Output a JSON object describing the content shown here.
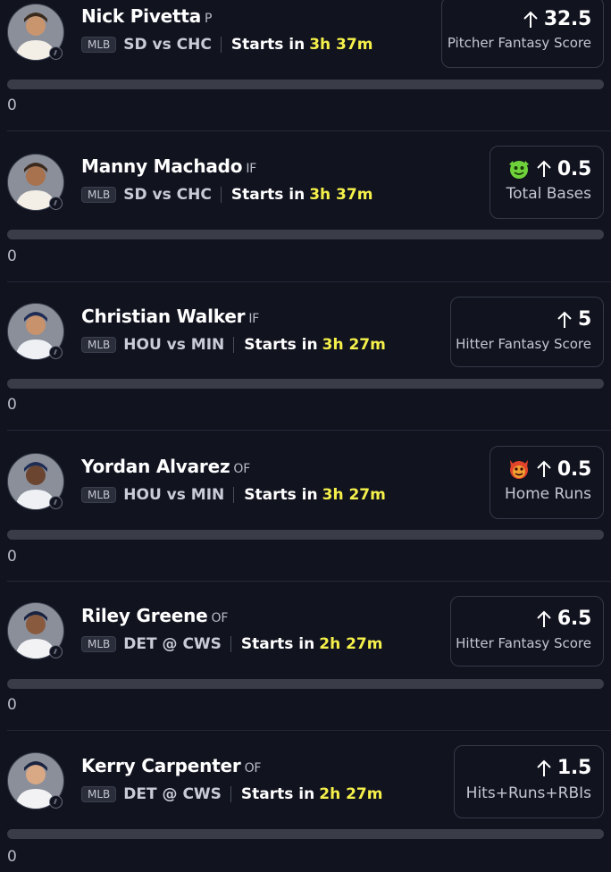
{
  "players": [
    {
      "name": "Nick Pivetta",
      "position": "P",
      "league": "MLB",
      "matchup": "SD vs CHC",
      "starts_label": "Starts in",
      "starts_time": "3h 37m",
      "value": "32.5",
      "stat": "Pitcher Fantasy Score",
      "emoji": "",
      "count": "0",
      "jersey_color": "#4a3a28"
    },
    {
      "name": "Manny Machado",
      "position": "IF",
      "league": "MLB",
      "matchup": "SD vs CHC",
      "starts_label": "Starts in",
      "starts_time": "3h 37m",
      "value": "0.5",
      "stat": "Total Bases",
      "emoji": "goblin-icon",
      "count": "0",
      "jersey_color": "#4a3a28"
    },
    {
      "name": "Christian Walker",
      "position": "IF",
      "league": "MLB",
      "matchup": "HOU vs MIN",
      "starts_label": "Starts in",
      "starts_time": "3h 27m",
      "value": "5",
      "stat": "Hitter Fantasy Score",
      "emoji": "",
      "count": "0",
      "jersey_color": "#1f2d55"
    },
    {
      "name": "Yordan Alvarez",
      "position": "OF",
      "league": "MLB",
      "matchup": "HOU vs MIN",
      "starts_label": "Starts in",
      "starts_time": "3h 27m",
      "value": "0.5",
      "stat": "Home Runs",
      "emoji": "demon-icon",
      "count": "0",
      "jersey_color": "#1f2d55"
    },
    {
      "name": "Riley Greene",
      "position": "OF",
      "league": "MLB",
      "matchup": "DET @ CWS",
      "starts_label": "Starts in",
      "starts_time": "2h 27m",
      "value": "6.5",
      "stat": "Hitter Fantasy Score",
      "emoji": "",
      "count": "0",
      "jersey_color": "#1a2440"
    },
    {
      "name": "Kerry Carpenter",
      "position": "OF",
      "league": "MLB",
      "matchup": "DET @ CWS",
      "starts_label": "Starts in",
      "starts_time": "2h 27m",
      "value": "1.5",
      "stat": "Hits+Runs+RBIs",
      "emoji": "",
      "count": "0",
      "jersey_color": "#1a2440"
    }
  ],
  "colors": {
    "background": "#11131f",
    "accent_time": "#f5f04a",
    "progress_track": "#3a3d48"
  }
}
